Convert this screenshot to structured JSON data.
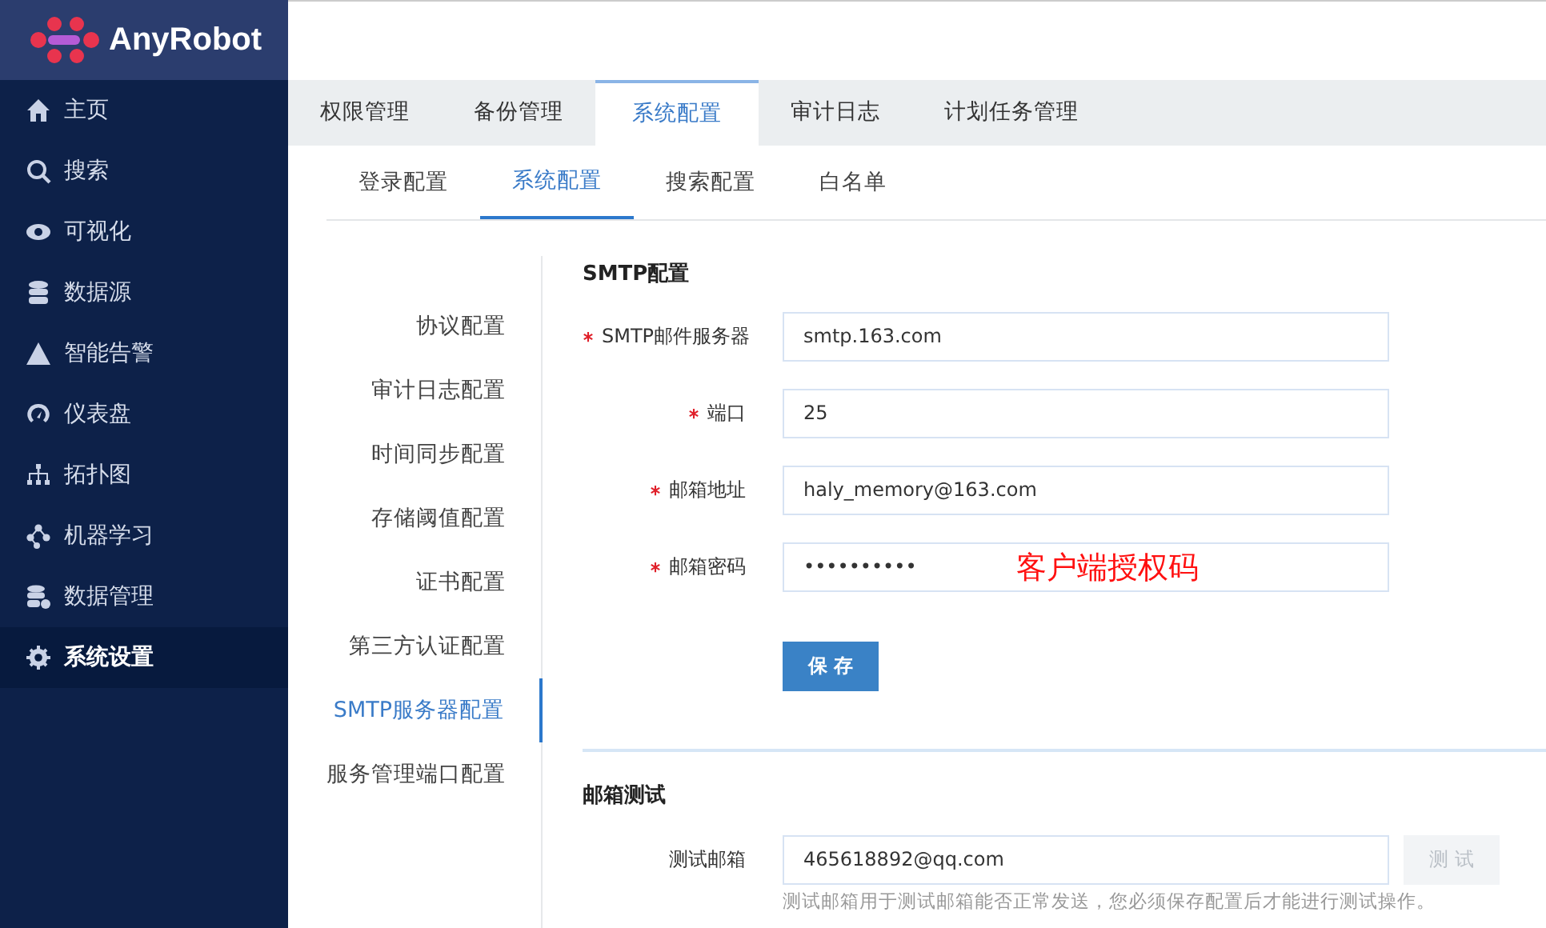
{
  "brand": "AnyRobot",
  "sidebar": {
    "items": [
      {
        "label": "主页",
        "selected": false
      },
      {
        "label": "搜索",
        "selected": false
      },
      {
        "label": "可视化",
        "selected": false
      },
      {
        "label": "数据源",
        "selected": false
      },
      {
        "label": "智能告警",
        "selected": false
      },
      {
        "label": "仪表盘",
        "selected": false
      },
      {
        "label": "拓扑图",
        "selected": false
      },
      {
        "label": "机器学习",
        "selected": false
      },
      {
        "label": "数据管理",
        "selected": false
      },
      {
        "label": "系统设置",
        "selected": true
      }
    ]
  },
  "tabs": [
    {
      "label": "权限管理",
      "selected": false
    },
    {
      "label": "备份管理",
      "selected": false
    },
    {
      "label": "系统配置",
      "selected": true
    },
    {
      "label": "审计日志",
      "selected": false
    },
    {
      "label": "计划任务管理",
      "selected": false
    }
  ],
  "subtabs": [
    {
      "label": "登录配置",
      "selected": false
    },
    {
      "label": "系统配置",
      "selected": true
    },
    {
      "label": "搜索配置",
      "selected": false
    },
    {
      "label": "白名单",
      "selected": false
    }
  ],
  "config_nav": [
    {
      "label": "协议配置",
      "selected": false
    },
    {
      "label": "审计日志配置",
      "selected": false
    },
    {
      "label": "时间同步配置",
      "selected": false
    },
    {
      "label": "存储阈值配置",
      "selected": false
    },
    {
      "label": "证书配置",
      "selected": false
    },
    {
      "label": "第三方认证配置",
      "selected": false
    },
    {
      "label": "SMTP服务器配置",
      "selected": true
    },
    {
      "label": "服务管理端口配置",
      "selected": false
    }
  ],
  "smtp": {
    "title": "SMTP配置",
    "fields": [
      {
        "label": "SMTP邮件服务器",
        "required": true,
        "value": "smtp.163.com"
      },
      {
        "label": "端口",
        "required": true,
        "value": "25"
      },
      {
        "label": "邮箱地址",
        "required": true,
        "value": "haly_memory@163.com"
      },
      {
        "label": "邮箱密码",
        "required": true,
        "value": "••••••••••",
        "annotation": "客户端授权码"
      }
    ],
    "save_button": "保 存"
  },
  "mail_test": {
    "title": "邮箱测试",
    "label": "测试邮箱",
    "value": "465618892@qq.com",
    "button": "测 试",
    "button_disabled": true,
    "hint": "测试邮箱用于测试邮箱能否正常发送，您必须保存配置后才能进行测试操作。"
  }
}
